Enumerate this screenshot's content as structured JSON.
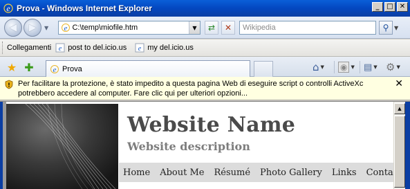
{
  "window": {
    "title": "Prova - Windows Internet Explorer",
    "minimize": "_",
    "maximize": "□",
    "close": "✕"
  },
  "address": {
    "url": "C:\\temp\\miofile.htm",
    "search_placeholder": "Wikipedia"
  },
  "links_bar": {
    "label": "Collegamenti",
    "items": [
      {
        "label": "post to del.icio.us"
      },
      {
        "label": "my del.icio.us"
      }
    ]
  },
  "tab": {
    "label": "Prova"
  },
  "info_bar": {
    "message": "Per facilitare la protezione, è stato impedito a questa pagina Web di eseguire script o controlli ActiveXc potrebbero accedere al computer. Fare clic qui per ulteriori opzioni...",
    "close": "✕"
  },
  "page": {
    "site_title": "Website Name",
    "site_description": "Website description",
    "nav": [
      "Home",
      "About Me",
      "Résumé",
      "Photo Gallery",
      "Links",
      "Contact"
    ]
  },
  "colors": {
    "titlebar": "#0a5fd8",
    "infobar": "#ffffe1",
    "site_title": "#4a4a4a",
    "site_description": "#7d7d7d",
    "nav_bg": "#dcdcdc"
  }
}
